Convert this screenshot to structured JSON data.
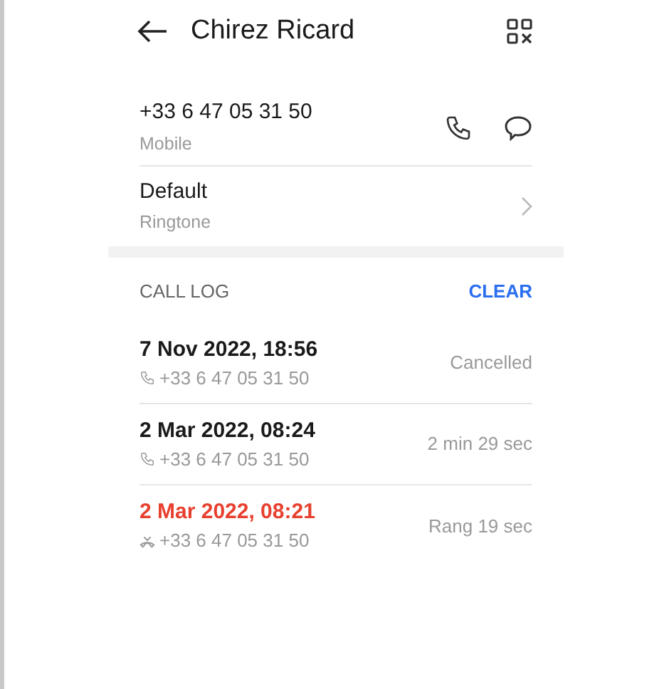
{
  "header": {
    "title": "Chirez Ricard"
  },
  "phone": {
    "number": "+33 6 47 05 31 50",
    "label": "Mobile"
  },
  "ringtone": {
    "value": "Default",
    "label": "Ringtone"
  },
  "call_log": {
    "title": "CALL LOG",
    "clear": "CLEAR",
    "entries": [
      {
        "date": "7 Nov 2022, 18:56",
        "number": "+33 6 47 05 31 50",
        "detail": "Cancelled",
        "kind": "outgoing"
      },
      {
        "date": "2 Mar 2022, 08:24",
        "number": "+33 6 47 05 31 50",
        "detail": "2 min 29 sec",
        "kind": "outgoing"
      },
      {
        "date": "2 Mar 2022, 08:21",
        "number": "+33 6 47 05 31 50",
        "detail": "Rang 19 sec",
        "kind": "missed"
      }
    ]
  }
}
